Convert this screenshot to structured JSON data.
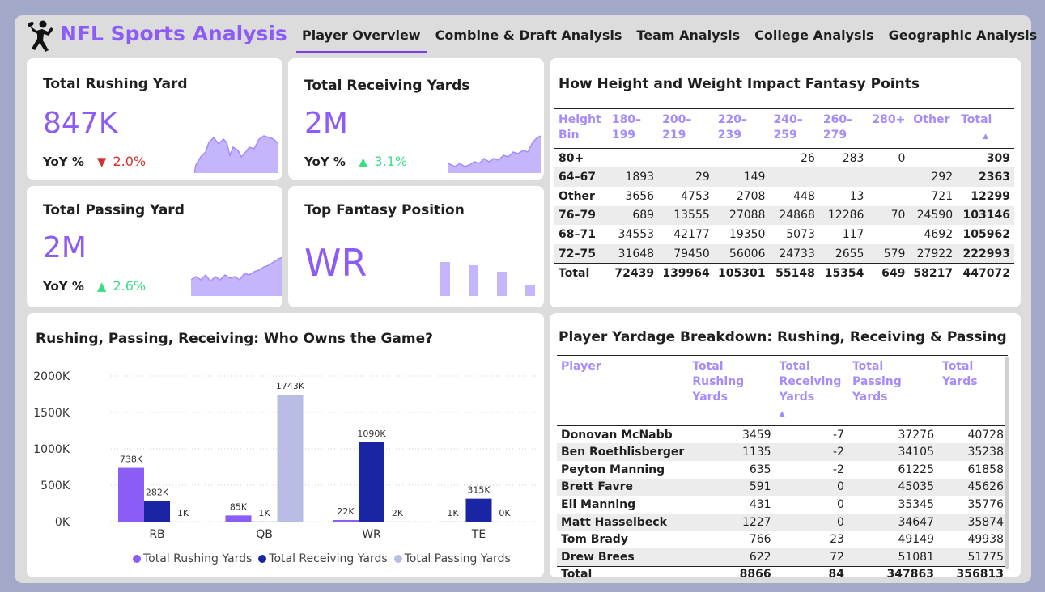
{
  "header": {
    "title": "NFL Sports Analysis",
    "logo_icon": "football-player-icon",
    "tabs": [
      {
        "label": "Player Overview",
        "active": true
      },
      {
        "label": "Combine & Draft Analysis",
        "active": false
      },
      {
        "label": "Team Analysis",
        "active": false
      },
      {
        "label": "College Analysis",
        "active": false
      },
      {
        "label": "Geographic Analysis",
        "active": false
      }
    ]
  },
  "colors": {
    "accent": "#8b5cf6",
    "rushing": "#8b5cf6",
    "receiving": "#1a25a3",
    "passing": "#b9bde6",
    "down": "#d32f2f",
    "up": "#3ddc84"
  },
  "kpis": {
    "rushing": {
      "title": "Total Rushing Yard",
      "value": "847K",
      "yoy_label": "YoY %",
      "yoy_direction": "down",
      "yoy_icon": "triangle-down-icon",
      "yoy_value": "2.0%"
    },
    "receiving": {
      "title": "Total Receiving Yards",
      "value": "2M",
      "yoy_label": "YoY %",
      "yoy_direction": "up",
      "yoy_icon": "triangle-up-icon",
      "yoy_value": "3.1%"
    },
    "passing": {
      "title": "Total Passing Yard",
      "value": "2M",
      "yoy_label": "YoY %",
      "yoy_direction": "up",
      "yoy_icon": "triangle-up-icon",
      "yoy_value": "2.6%"
    },
    "position": {
      "title": "Top Fantasy Position",
      "value": "WR"
    }
  },
  "fantasy_matrix": {
    "title": "How Height and Weight Impact Fantasy Points",
    "columns": [
      "Height Bin",
      "180–199",
      "200–219",
      "220–239",
      "240–259",
      "260–279",
      "280+",
      "Other",
      "Total"
    ],
    "rows": [
      {
        "label": "80+",
        "cells": [
          "",
          "",
          "",
          "26",
          "283",
          "0",
          "",
          "309"
        ]
      },
      {
        "label": "64–67",
        "cells": [
          "1893",
          "29",
          "149",
          "",
          "",
          "",
          "292",
          "2363"
        ]
      },
      {
        "label": "Other",
        "cells": [
          "3656",
          "4753",
          "2708",
          "448",
          "13",
          "",
          "721",
          "12299"
        ]
      },
      {
        "label": "76–79",
        "cells": [
          "689",
          "13555",
          "27088",
          "24868",
          "12286",
          "70",
          "24590",
          "103146"
        ]
      },
      {
        "label": "68–71",
        "cells": [
          "34553",
          "42177",
          "19350",
          "5073",
          "117",
          "",
          "4692",
          "105962"
        ]
      },
      {
        "label": "72–75",
        "cells": [
          "31648",
          "79450",
          "56006",
          "24733",
          "2655",
          "579",
          "27922",
          "222993"
        ]
      }
    ],
    "total": {
      "label": "Total",
      "cells": [
        "72439",
        "139964",
        "105301",
        "55148",
        "15354",
        "649",
        "58217",
        "447072"
      ]
    }
  },
  "chart_data": {
    "type": "bar",
    "title": "Rushing, Passing, Receiving: Who Owns the Game?",
    "categories": [
      "RB",
      "QB",
      "WR",
      "TE"
    ],
    "series": [
      {
        "name": "Total Rushing Yards",
        "values": [
          738,
          85,
          22,
          1
        ],
        "labels": [
          "738K",
          "85K",
          "22K",
          "1K"
        ]
      },
      {
        "name": "Total Receiving Yards",
        "values": [
          282,
          1,
          1090,
          315
        ],
        "labels": [
          "282K",
          "1K",
          "1090K",
          "315K"
        ]
      },
      {
        "name": "Total Passing Yards",
        "values": [
          1,
          1743,
          2,
          0
        ],
        "labels": [
          "1K",
          "1743K",
          "2K",
          "0K"
        ]
      }
    ],
    "ylim": [
      0,
      2000
    ],
    "yticks": [
      "0K",
      "500K",
      "1000K",
      "1500K",
      "2000K"
    ],
    "grid": true,
    "legend": "bottom"
  },
  "yardage_table": {
    "title": "Player Yardage Breakdown: Rushing, Receiving & Passing",
    "columns": [
      "Player",
      "Total Rushing Yards",
      "Total Receiving Yards",
      "Total Passing Yards",
      "Total Yards"
    ],
    "rows": [
      [
        "Donovan McNabb",
        "3459",
        "-7",
        "37276",
        "40728"
      ],
      [
        "Ben Roethlisberger",
        "1135",
        "-2",
        "34105",
        "35238"
      ],
      [
        "Peyton Manning",
        "635",
        "-2",
        "61225",
        "61858"
      ],
      [
        "Brett Favre",
        "591",
        "0",
        "45035",
        "45626"
      ],
      [
        "Eli Manning",
        "431",
        "0",
        "35345",
        "35776"
      ],
      [
        "Matt Hasselbeck",
        "1227",
        "0",
        "34647",
        "35874"
      ],
      [
        "Tom Brady",
        "766",
        "23",
        "49149",
        "49938"
      ],
      [
        "Drew Brees",
        "622",
        "72",
        "51081",
        "51775"
      ]
    ],
    "total": [
      "Total",
      "8866",
      "84",
      "347863",
      "356813"
    ]
  }
}
